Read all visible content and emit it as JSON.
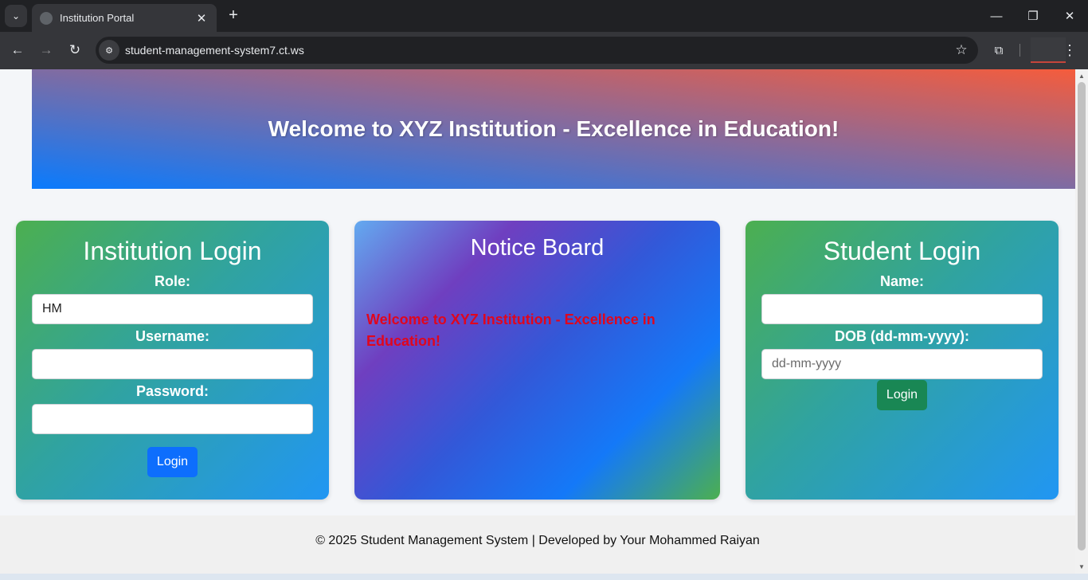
{
  "browser": {
    "tab_title": "Institution Portal",
    "url": "student-management-system7.ct.ws"
  },
  "header": {
    "title": "Welcome to XYZ Institution - Excellence in Education!"
  },
  "institution_login": {
    "title": "Institution Login",
    "role_label": "Role:",
    "role_value": "HM",
    "username_label": "Username:",
    "username_value": "",
    "password_label": "Password:",
    "password_value": "",
    "button_label": "Login"
  },
  "notice_board": {
    "title": "Notice Board",
    "message": "Welcome to XYZ Institution - Excellence in Education!"
  },
  "student_login": {
    "title": "Student Login",
    "name_label": "Name:",
    "name_value": "",
    "dob_label": "DOB (dd-mm-yyyy):",
    "dob_placeholder": "dd-mm-yyyy",
    "button_label": "Login"
  },
  "footer": {
    "text": "© 2025 Student Management System | Developed by Your Mohammed Raiyan"
  },
  "colors": {
    "banner_start": "#0a7bfd",
    "banner_end": "#f55c3c",
    "card_green": "#4caf50",
    "card_blue": "#2196f3",
    "primary_button": "#0d6efd",
    "success_button": "#198754",
    "notice_text": "#e0061e"
  }
}
